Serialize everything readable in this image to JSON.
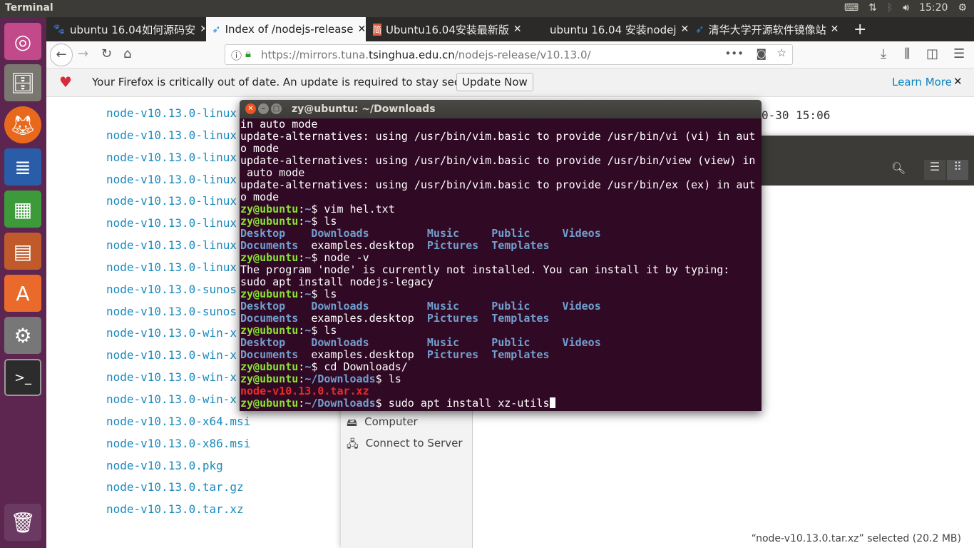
{
  "topbar": {
    "title": "Terminal",
    "time": "15:20"
  },
  "firefox": {
    "tabs": [
      {
        "label": "ubuntu 16.04如何源码安"
      },
      {
        "label": "Index of /nodejs-release"
      },
      {
        "label": "Ubuntu16.04安装最新版"
      },
      {
        "label": "ubuntu 16.04 安装nodej"
      },
      {
        "label": "清华大学开源软件镜像站"
      }
    ],
    "url_pre": "https://mirrors.tuna.",
    "url_host": "tsinghua.edu.cn",
    "url_post": "/nodejs-release/v10.13.0/",
    "notice": "Your Firefox is critically out of date. An update is required to stay secure.",
    "update_now": "Update Now",
    "learn_more": "Learn More",
    "files": [
      "node-v10.13.0-linux",
      "node-v10.13.0-linux",
      "node-v10.13.0-linux",
      "node-v10.13.0-linux",
      "node-v10.13.0-linux",
      "node-v10.13.0-linux",
      "node-v10.13.0-linux",
      "node-v10.13.0-linux",
      "node-v10.13.0-sunos",
      "node-v10.13.0-sunos",
      "node-v10.13.0-win-x",
      "node-v10.13.0-win-x",
      "node-v10.13.0-win-x",
      "node-v10.13.0-win-x",
      "node-v10.13.0-x64.msi",
      "node-v10.13.0-x86.msi",
      "node-v10.13.0.pkg",
      "node-v10.13.0.tar.gz",
      "node-v10.13.0.tar.xz"
    ],
    "date_fragment": "0-30 15:06"
  },
  "nautilus": {
    "sidebar": [
      "Computer",
      "Connect to Server"
    ],
    "status": "“node-v10.13.0.tar.xz” selected  (20.2 MB)"
  },
  "terminal": {
    "title": "zy@ubuntu: ~/Downloads",
    "lines": [
      [
        [
          "w",
          "in auto mode"
        ]
      ],
      [
        [
          "w",
          "update-alternatives: using /usr/bin/vim.basic to provide /usr/bin/vi (vi) in aut"
        ]
      ],
      [
        [
          "w",
          "o mode"
        ]
      ],
      [
        [
          "w",
          "update-alternatives: using /usr/bin/vim.basic to provide /usr/bin/view (view) in"
        ]
      ],
      [
        [
          "w",
          " auto mode"
        ]
      ],
      [
        [
          "w",
          "update-alternatives: using /usr/bin/vim.basic to provide /usr/bin/ex (ex) in aut"
        ]
      ],
      [
        [
          "w",
          "o mode"
        ]
      ],
      [
        [
          "g",
          "zy@ubuntu"
        ],
        [
          "w",
          ":"
        ],
        [
          "b",
          "~"
        ],
        [
          "w",
          "$ vim hel.txt"
        ]
      ],
      [
        [
          "g",
          "zy@ubuntu"
        ],
        [
          "w",
          ":"
        ],
        [
          "b",
          "~"
        ],
        [
          "w",
          "$ ls"
        ]
      ],
      [
        [
          "b",
          "Desktop    Downloads         Music     Public     Videos"
        ]
      ],
      [
        [
          "b",
          "Documents  "
        ],
        [
          "w",
          "examples.desktop  "
        ],
        [
          "b",
          "Pictures  Templates"
        ]
      ],
      [
        [
          "g",
          "zy@ubuntu"
        ],
        [
          "w",
          ":"
        ],
        [
          "b",
          "~"
        ],
        [
          "w",
          "$ node -v"
        ]
      ],
      [
        [
          "w",
          "The program 'node' is currently not installed. You can install it by typing:"
        ]
      ],
      [
        [
          "w",
          "sudo apt install nodejs-legacy"
        ]
      ],
      [
        [
          "g",
          "zy@ubuntu"
        ],
        [
          "w",
          ":"
        ],
        [
          "b",
          "~"
        ],
        [
          "w",
          "$ ls"
        ]
      ],
      [
        [
          "b",
          "Desktop    Downloads         Music     Public     Videos"
        ]
      ],
      [
        [
          "b",
          "Documents  "
        ],
        [
          "w",
          "examples.desktop  "
        ],
        [
          "b",
          "Pictures  Templates"
        ]
      ],
      [
        [
          "g",
          "zy@ubuntu"
        ],
        [
          "w",
          ":"
        ],
        [
          "b",
          "~"
        ],
        [
          "w",
          "$ ls"
        ]
      ],
      [
        [
          "b",
          "Desktop    Downloads         Music     Public     Videos"
        ]
      ],
      [
        [
          "b",
          "Documents  "
        ],
        [
          "w",
          "examples.desktop  "
        ],
        [
          "b",
          "Pictures  Templates"
        ]
      ],
      [
        [
          "g",
          "zy@ubuntu"
        ],
        [
          "w",
          ":"
        ],
        [
          "b",
          "~"
        ],
        [
          "w",
          "$ cd Downloads/"
        ]
      ],
      [
        [
          "g",
          "zy@ubuntu"
        ],
        [
          "w",
          ":"
        ],
        [
          "b",
          "~/Downloads"
        ],
        [
          "w",
          "$ ls"
        ]
      ],
      [
        [
          "r",
          "node-v10.13.0.tar.xz"
        ]
      ],
      [
        [
          "g",
          "zy@ubuntu"
        ],
        [
          "w",
          ":"
        ],
        [
          "b",
          "~/Downloads"
        ],
        [
          "w",
          "$ sudo apt install xz-utils"
        ]
      ]
    ]
  }
}
